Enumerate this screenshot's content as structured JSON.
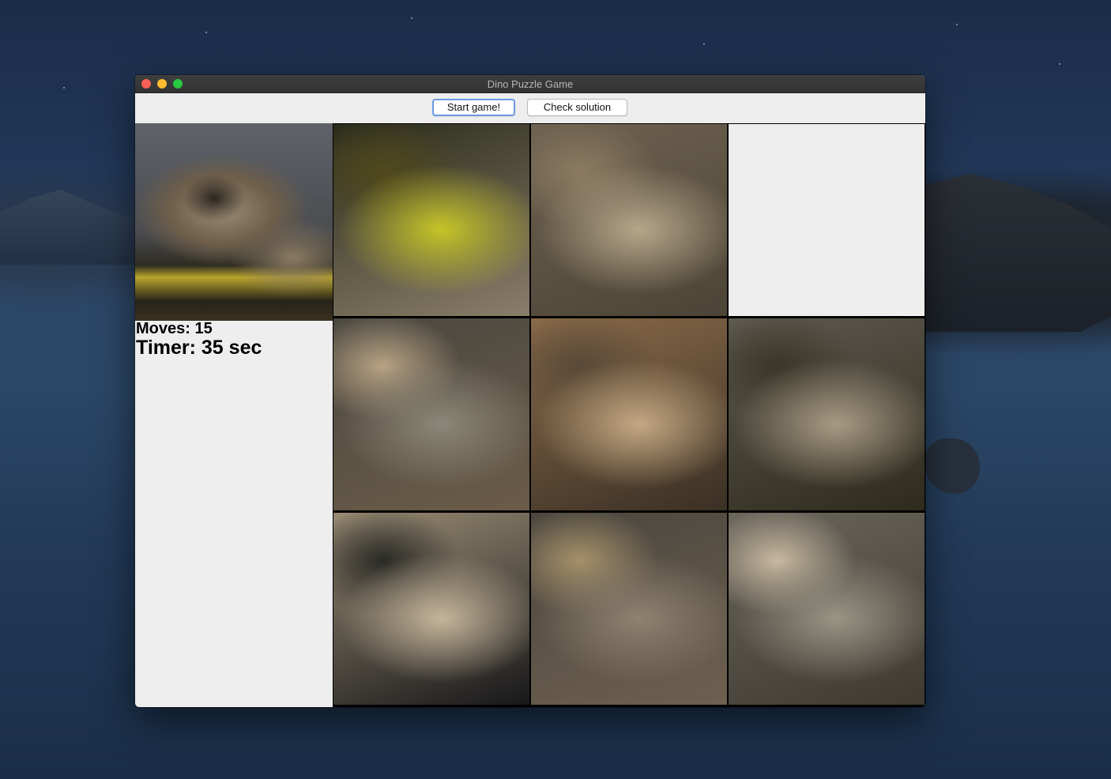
{
  "window": {
    "title": "Dino Puzzle Game"
  },
  "toolbar": {
    "start_label": "Start game!",
    "check_label": "Check solution"
  },
  "stats": {
    "moves_label": "Moves:",
    "moves_value": "15",
    "timer_label": "Timer:",
    "timer_value": "35",
    "timer_unit": "sec"
  },
  "board": {
    "rows": 3,
    "cols": 3,
    "empty_index": 2,
    "tiles": [
      {
        "name": "tile-1",
        "colors": [
          "#2a2b1a",
          "#c6c427",
          "#50491c",
          "#8a7e6a"
        ]
      },
      {
        "name": "tile-2",
        "colors": [
          "#6e6250",
          "#b6a68a",
          "#8c7b62",
          "#4c4436"
        ]
      },
      {
        "name": "tile-3",
        "empty": true
      },
      {
        "name": "tile-4",
        "colors": [
          "#4a4840",
          "#8c8778",
          "#b8a284",
          "#6b5c48"
        ]
      },
      {
        "name": "tile-5",
        "colors": [
          "#8a6a4a",
          "#c4a884",
          "#5a4a38",
          "#3a3024"
        ]
      },
      {
        "name": "tile-6",
        "colors": [
          "#5e5a50",
          "#a89a84",
          "#3a3628",
          "#2e2a1c"
        ]
      },
      {
        "name": "tile-7",
        "colors": [
          "#9a8c74",
          "#c4b49a",
          "#2a2a26",
          "#18181a"
        ]
      },
      {
        "name": "tile-8",
        "colors": [
          "#4a463e",
          "#8e8270",
          "#a6906a",
          "#6e6050"
        ]
      },
      {
        "name": "tile-9",
        "colors": [
          "#6a665c",
          "#9a9484",
          "#c8b8a0",
          "#3e3a32"
        ]
      }
    ]
  }
}
